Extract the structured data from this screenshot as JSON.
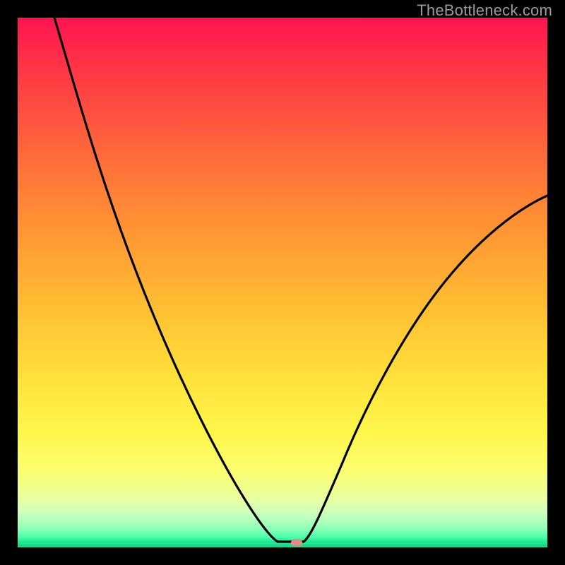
{
  "watermark": "TheBottleneck.com",
  "chart_data": {
    "type": "line",
    "title": "",
    "xlabel": "",
    "ylabel": "",
    "xlim": [
      0,
      100
    ],
    "ylim": [
      0,
      100
    ],
    "series": [
      {
        "name": "bottleneck-curve",
        "x": [
          7,
          10,
          15,
          20,
          25,
          30,
          35,
          40,
          45,
          48,
          50,
          51,
          52,
          53,
          54,
          56,
          60,
          65,
          70,
          75,
          80,
          85,
          90,
          95,
          100
        ],
        "values": [
          100,
          91,
          78,
          66,
          55,
          45,
          36,
          27,
          17,
          8,
          2,
          0.5,
          0.5,
          0.5,
          1,
          5,
          14,
          24,
          33,
          41,
          48,
          54,
          59,
          63,
          66
        ]
      }
    ],
    "marker": {
      "x": 52.5,
      "y": 0.5
    },
    "background_gradient": {
      "top": "#ff1452",
      "mid": "#ffe13a",
      "bottom": "#17d288"
    }
  }
}
